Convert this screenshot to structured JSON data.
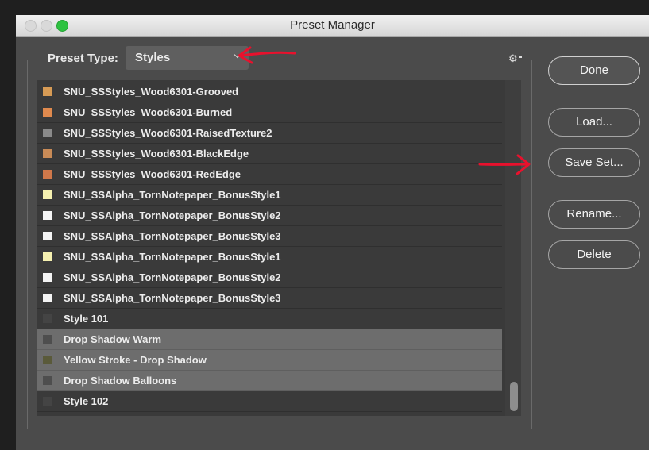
{
  "window": {
    "title": "Preset Manager"
  },
  "preset_type": {
    "label": "Preset Type:",
    "value": "Styles"
  },
  "list": {
    "items": [
      {
        "label": "SNU_SSStyles_Wood6301-Grooved",
        "swatch": "#d79b55",
        "selected": false
      },
      {
        "label": "SNU_SSStyles_Wood6301-Burned",
        "swatch": "#e08a4e",
        "selected": false
      },
      {
        "label": "SNU_SSStyles_Wood6301-RaisedTexture2",
        "swatch": "#8a8a8a",
        "selected": false
      },
      {
        "label": "SNU_SSStyles_Wood6301-BlackEdge",
        "swatch": "#c98b57",
        "selected": false
      },
      {
        "label": "SNU_SSStyles_Wood6301-RedEdge",
        "swatch": "#d0784a",
        "selected": false
      },
      {
        "label": "SNU_SSAlpha_TornNotepaper_BonusStyle1",
        "swatch": "#f5f0b0",
        "selected": false
      },
      {
        "label": "SNU_SSAlpha_TornNotepaper_BonusStyle2",
        "swatch": "#f4f4f4",
        "selected": false
      },
      {
        "label": "SNU_SSAlpha_TornNotepaper_BonusStyle3",
        "swatch": "#f4f4f4",
        "selected": false
      },
      {
        "label": "SNU_SSAlpha_TornNotepaper_BonusStyle1",
        "swatch": "#f5f0b0",
        "selected": false
      },
      {
        "label": "SNU_SSAlpha_TornNotepaper_BonusStyle2",
        "swatch": "#f4f4f4",
        "selected": false
      },
      {
        "label": "SNU_SSAlpha_TornNotepaper_BonusStyle3",
        "swatch": "#f4f4f4",
        "selected": false
      },
      {
        "label": "Style 101",
        "swatch": "#444444",
        "selected": false
      },
      {
        "label": "Drop Shadow Warm",
        "swatch": "#4e4e4e",
        "selected": true
      },
      {
        "label": "Yellow Stroke - Drop Shadow",
        "swatch": "#5a5a3a",
        "selected": true
      },
      {
        "label": "Drop Shadow Balloons",
        "swatch": "#4e4e4e",
        "selected": true
      },
      {
        "label": "Style 102",
        "swatch": "#444444",
        "selected": false
      }
    ]
  },
  "buttons": {
    "done": "Done",
    "load": "Load...",
    "save_set": "Save Set...",
    "rename": "Rename...",
    "delete": "Delete"
  },
  "icons": {
    "settings": "gear-icon",
    "dropdown": "chevron-down-icon",
    "annotation_arrows": "red-arrow-icon"
  },
  "colors": {
    "annotation": "#e8112d",
    "selection": "#6d6d6d",
    "panel": "#4b4b4b"
  }
}
